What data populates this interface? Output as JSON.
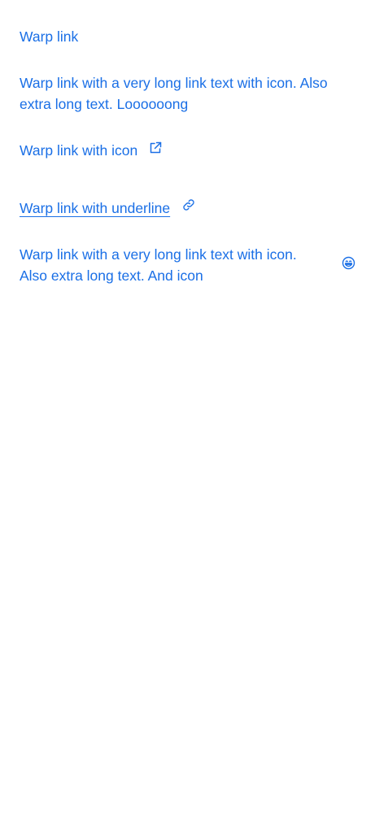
{
  "links": {
    "plain": {
      "label": "Warp link"
    },
    "long_with_icon": {
      "label": "Warp link with a very long link text with icon. Also extra long text. Loooooong"
    },
    "with_icon": {
      "label": "Warp link with icon",
      "icon": "external-link-icon"
    },
    "with_underline": {
      "label": "Warp link with underline",
      "icon": "chain-link-icon"
    },
    "long_with_end_icon": {
      "label": "Warp link with a very long link text with icon. Also extra long text. And icon",
      "icon": "smiley-icon"
    }
  },
  "colors": {
    "link": "#1a6fe6",
    "background": "#ffffff"
  }
}
